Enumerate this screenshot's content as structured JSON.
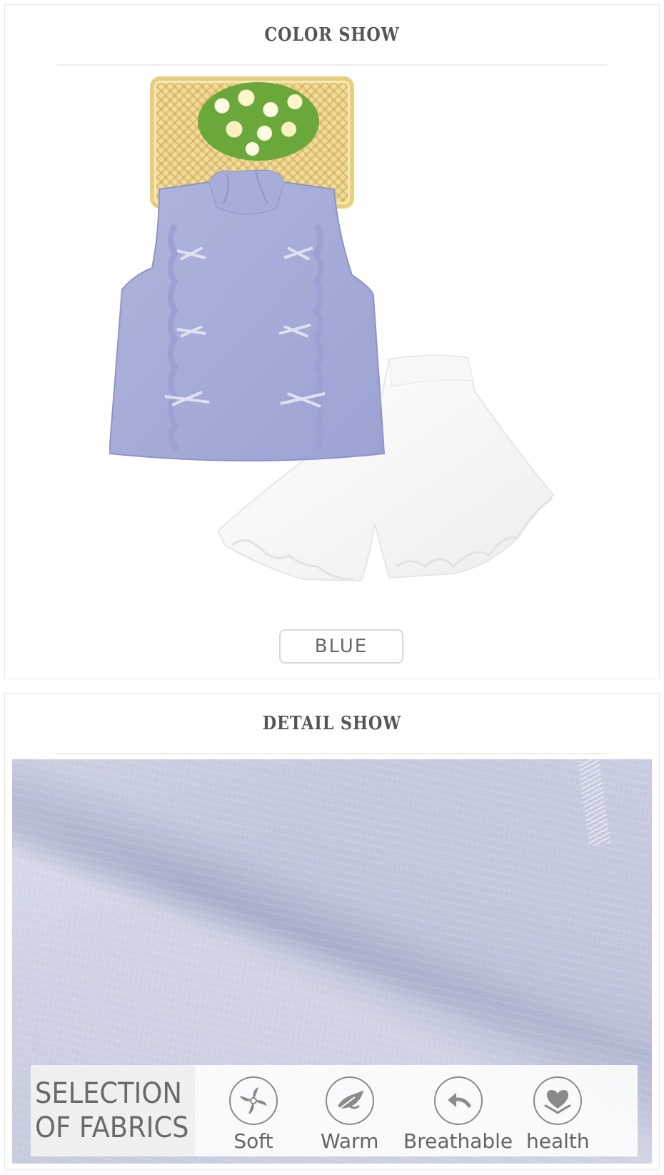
{
  "color_show": {
    "title": "COLOR SHOW",
    "color_label": "BLUE"
  },
  "detail_show": {
    "title": "DETAIL SHOW",
    "selection_line1": "SELECTION",
    "selection_line2": "OF FABRICS",
    "features": [
      {
        "label": "Soft",
        "icon": "swirl-icon"
      },
      {
        "label": "Warm",
        "icon": "feather-icon"
      },
      {
        "label": "Breathable",
        "icon": "return-arrow-icon"
      },
      {
        "label": "health",
        "icon": "heart-hand-icon"
      }
    ]
  },
  "colors": {
    "shirt": "#a9afdb",
    "shirt_dark": "#9aa0d0",
    "shorts": "#ffffff",
    "fabric": "#c4c8de",
    "basket": "#f2dc97"
  }
}
